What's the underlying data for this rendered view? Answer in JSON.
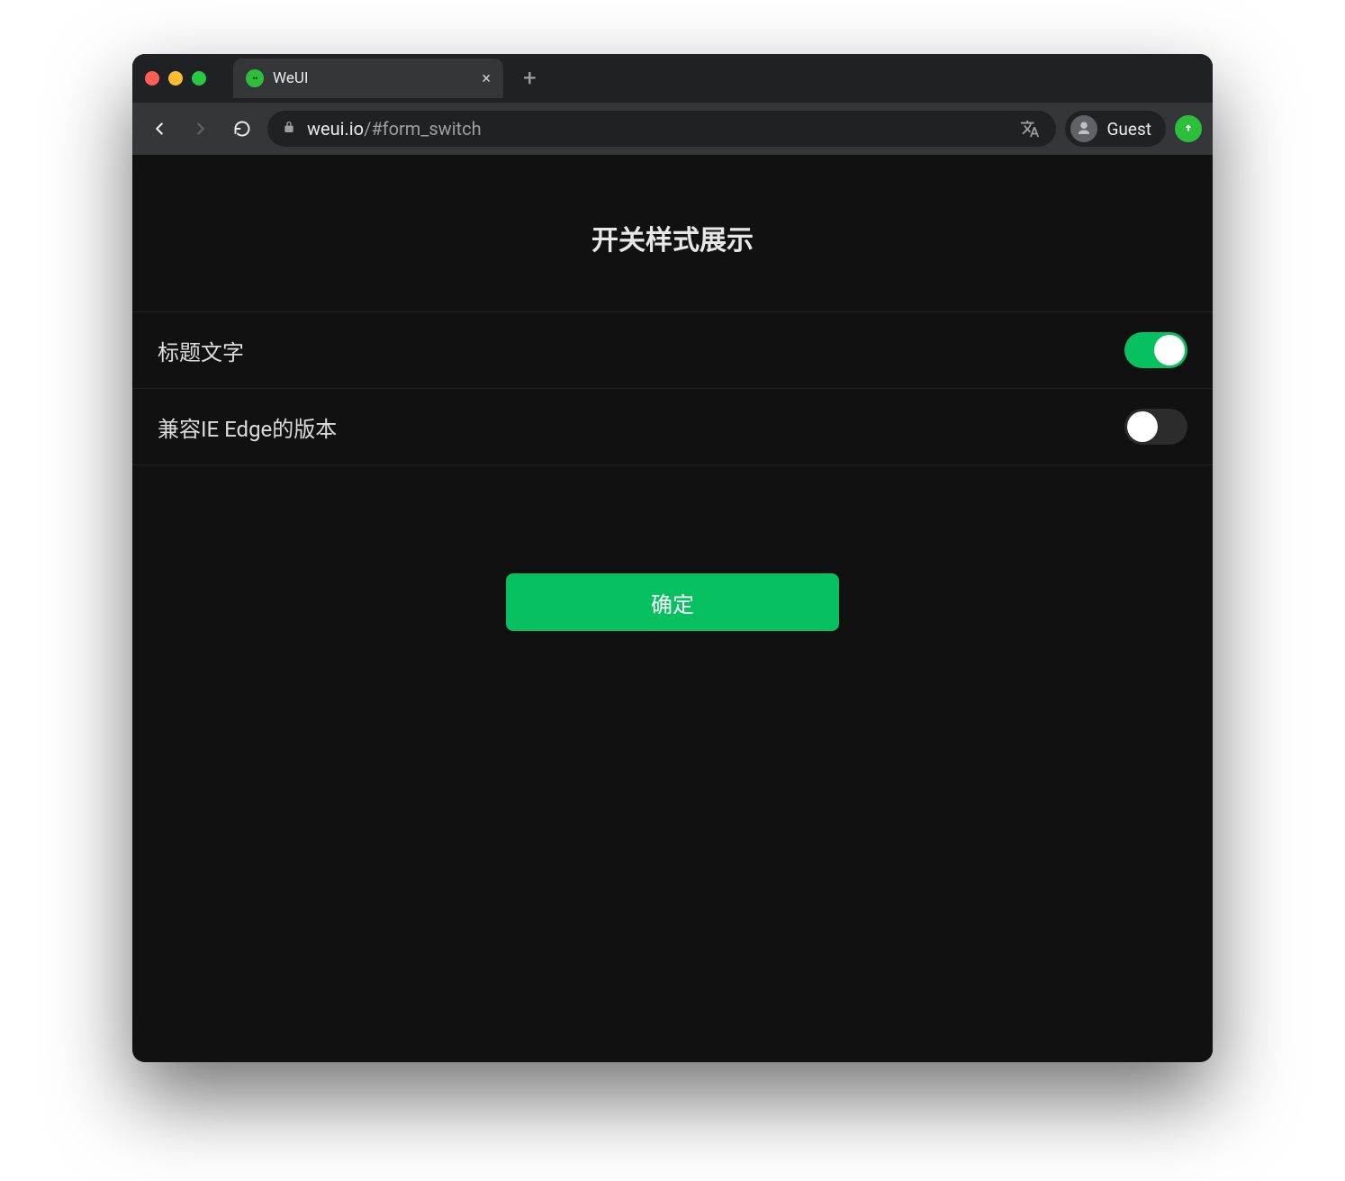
{
  "browser": {
    "tab_title": "WeUI",
    "url_host": "weui.io",
    "url_path": "/#form_switch",
    "profile_label": "Guest"
  },
  "page": {
    "title": "开关样式展示",
    "cells": [
      {
        "label": "标题文字",
        "on": true
      },
      {
        "label": "兼容IE Edge的版本",
        "on": false
      }
    ],
    "submit_label": "确定"
  },
  "colors": {
    "accent": "#07c160"
  }
}
